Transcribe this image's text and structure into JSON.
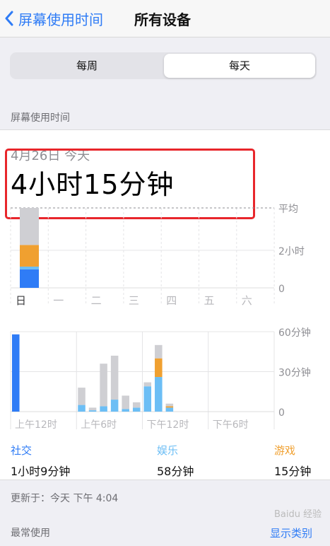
{
  "nav": {
    "back_label": "屏幕使用时间",
    "title": "所有设备"
  },
  "segment": {
    "options": [
      "每周",
      "每天"
    ],
    "selected": "每天"
  },
  "section_label": "屏幕使用时间",
  "summary": {
    "date": "4月26日 今天",
    "total": "4小时15分钟"
  },
  "colors": {
    "social": "#6cbef5",
    "entertainment": "#2f7cf6",
    "games": "#f0a030",
    "other": "#cfcfd3",
    "highlight": "#e8262b",
    "accent": "#2f7cf6"
  },
  "chart_data": [
    {
      "type": "bar",
      "categories": [
        "日",
        "一",
        "二",
        "三",
        "四",
        "五",
        "六"
      ],
      "series": [
        {
          "name": "",
          "values": [
            0.98,
            0,
            0,
            0,
            0,
            0,
            0
          ]
        },
        {
          "name": "",
          "values": [
            0.15,
            0,
            0,
            0,
            0,
            0,
            0
          ]
        },
        {
          "name": "",
          "values": [
            1.15,
            0,
            0,
            0,
            0,
            0,
            0
          ]
        },
        {
          "name": "",
          "values": [
            1.97,
            0,
            0,
            0,
            0,
            0,
            0
          ]
        }
      ],
      "ytick_labels": [
        "2小时",
        "0"
      ],
      "average_label": "平均",
      "ylim": [
        0,
        4.25
      ]
    },
    {
      "type": "bar",
      "x": [
        0,
        1,
        2,
        3,
        4,
        5,
        6,
        7,
        8,
        9,
        10,
        11,
        12,
        13,
        14,
        15,
        16,
        17,
        18,
        19,
        20,
        21,
        22,
        23
      ],
      "xtick_labels": [
        "上午12时",
        "上午6时",
        "下午12时",
        "下午6时"
      ],
      "ytick_labels": [
        "60分钟",
        "30分钟",
        "0"
      ],
      "ylim": [
        0,
        60
      ],
      "series": [
        {
          "name": "",
          "values": [
            58,
            0,
            0,
            0,
            0,
            0,
            0,
            0,
            0,
            0,
            0,
            0,
            0,
            0,
            0,
            0,
            0,
            0,
            0,
            0,
            0,
            0,
            0,
            0
          ]
        },
        {
          "name": "",
          "values": [
            0,
            0,
            0,
            0,
            0,
            0,
            5,
            1,
            4,
            9,
            2,
            3,
            19,
            26,
            3,
            0,
            0,
            0,
            0,
            0,
            0,
            0,
            0,
            0
          ]
        },
        {
          "name": "",
          "values": [
            0,
            0,
            0,
            0,
            0,
            0,
            0,
            0,
            0,
            0,
            0,
            0,
            0,
            14,
            1,
            0,
            0,
            0,
            0,
            0,
            0,
            0,
            0,
            0
          ]
        },
        {
          "name": "",
          "values": [
            0,
            0,
            0,
            0,
            0,
            0,
            13,
            2,
            32,
            33,
            10,
            4,
            3,
            10,
            2,
            0,
            0,
            0,
            0,
            0,
            0,
            0,
            0,
            0
          ]
        }
      ]
    }
  ],
  "legend": [
    {
      "label": "社交",
      "value": "1小时9分钟",
      "color": "#6cbef5"
    },
    {
      "label": "娱乐",
      "value": "58分钟",
      "color": "#6cbef5"
    },
    {
      "label": "游戏",
      "value": "15分钟",
      "color": "#f0a030"
    }
  ],
  "footer": {
    "updated": "更新于：今天 下午 4:04",
    "most_used": "最常使用",
    "show_categories": "显示类别"
  },
  "watermark": "Baidu 经验"
}
